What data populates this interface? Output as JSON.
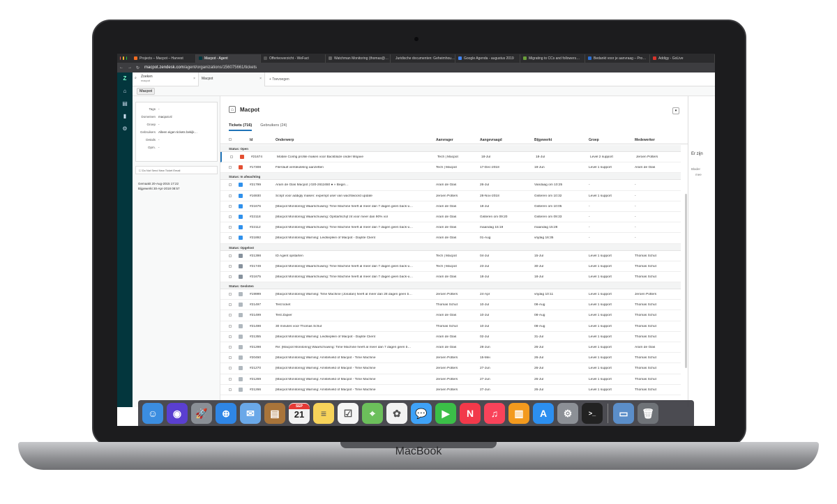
{
  "device": {
    "brand": "MacBook"
  },
  "browser": {
    "tabs": [
      {
        "label": "Projects – Macpot – Harvest",
        "icon_color": "#f36c21",
        "active": false
      },
      {
        "label": "Macpot - Agent",
        "icon_color": "#03363d",
        "active": true
      },
      {
        "label": "Offerteoverzicht - WeFact",
        "icon_color": "#555555",
        "active": false
      },
      {
        "label": "Watchman Monitoring (thomas@…",
        "icon_color": "#666666",
        "active": false
      },
      {
        "label": "Juridische documenten: Geheimhou…",
        "icon_color": "#3a6bd8",
        "active": false
      },
      {
        "label": "Google Agenda - augustus 2019",
        "icon_color": "#4285f4",
        "active": false
      },
      {
        "label": "Migrating to CCs and followers…",
        "icon_color": "#6a9e3a",
        "active": false
      },
      {
        "label": "Bedankt voor je aanvraag – Pro…",
        "icon_color": "#2c6fd1",
        "active": false
      },
      {
        "label": "Addigy - GoLive",
        "icon_color": "#d9342b",
        "active": false
      }
    ],
    "url_domain": "macpot.zendesk.com",
    "url_path": "/agent/organizations/156075661/tickets"
  },
  "app": {
    "search_tab": {
      "title": "Zoeken",
      "subtitle": "macpot"
    },
    "org_tab": "Macpot",
    "add_tab": "+ Toevoegen",
    "breadcrumb": "Macpot"
  },
  "org_props": {
    "rows": [
      {
        "k": "Tags",
        "v": "-"
      },
      {
        "k": "Domeinen",
        "v": "macpot.nl"
      },
      {
        "k": "Groep",
        "v": "-"
      },
      {
        "k": "Gebruikers",
        "v": "Alleen eigen tickets bekijk…"
      },
      {
        "k": "Details",
        "v": "-"
      },
      {
        "k": "Opm.",
        "v": "-"
      }
    ],
    "checkbox_label": "Do Not Send New Ticket Email",
    "created_label": "Gemaakt",
    "created": "20-Aug-2015 17:22",
    "updated_label": "Bijgewerkt",
    "updated": "30-Apr-2018 08:57"
  },
  "org": {
    "name": "Macpot",
    "tab_tickets": "Tickets (716)",
    "tab_users": "Gebruikers (24)"
  },
  "table": {
    "headers": {
      "id": "Id",
      "subject": "Onderwerp",
      "requester": "Aanvrager",
      "requested": "Aangevraagd",
      "updated": "Bijgewerkt",
      "group": "Groep",
      "assignee": "Medewerker"
    },
    "groups": [
      {
        "label": "Status: Open",
        "color": "#e34f32",
        "rows": [
          [
            "#21674",
            "Mobile Config profile maken voor Backblaze onder Mojave",
            "Tech | Macpot",
            "18-Jul",
            "18-Jul",
            "Level 2 support",
            "Jeroen Potters"
          ],
          [
            "#17308",
            "FileVault versleuteling aanzetten",
            "Tech | Macpot",
            "17-Dec-2018",
            "19-Jun",
            "Level 1 support",
            "Aram de Glas"
          ]
        ]
      },
      {
        "label": "Status: In afwachting",
        "color": "#3091ec",
        "rows": [
          [
            "#21799",
            "Aram de Glas Macpot | 020-2611650 ● » Begin…",
            "Aram de Glas",
            "26-Jul",
            "Vandaag om 10:25",
            "-",
            "-"
          ],
          [
            "#16930",
            "Script voor addigly maken: expempt user van wachtwoord update",
            "Jeroen Potters",
            "28-Nov-2018",
            "Gisteren om 10:32",
            "Level 1 support",
            "-"
          ],
          [
            "#21676",
            "[Macpot Monitoring] Waarschuwing: Time Machine heeft al meer dan 7 dagen geen back-u…",
            "Aram de Glas",
            "18-Jul",
            "Gisteren om 10:05",
            "-",
            "-"
          ],
          [
            "#22118",
            "[Macpot Monitoring] Waarschuwing: Opstartschijf zit voor meer dan 90% vol",
            "Aram de Glas",
            "Gisteren om 09:20",
            "Gisteren om 09:33",
            "-",
            "-"
          ],
          [
            "#22112",
            "[Macpot Monitoring] Waarschuwing: Time Machine heeft al meer dan 7 dagen geen back-u…",
            "Aram de Glas",
            "maandag 15:19",
            "maandag 15:28",
            "-",
            "-"
          ],
          [
            "#21892",
            "[Macpot Monitoring] Warning: Leidseplein of Macpot - Daylite Client",
            "Aram de Glas",
            "01-Aug",
            "vrijdag 16:35",
            "-",
            "-"
          ]
        ]
      },
      {
        "label": "Status: Opgelost",
        "color": "#87929d",
        "rows": [
          [
            "#21398",
            "ID Agent opstarten",
            "Tech | Macpot",
            "04-Jul",
            "15-Jul",
            "Level 1 support",
            "Thomas Schut"
          ],
          [
            "#21749",
            "[Macpot Monitoring] Waarschuwing: Time Machine heeft al meer dan 7 dagen geen back-u…",
            "Tech | Macpot",
            "23-Jul",
            "30-Jul",
            "Level 1 support",
            "Thomas Schut"
          ],
          [
            "#21675",
            "[Macpot Monitoring] Waarschuwing: Time Machine heeft al meer dan 7 dagen geen back-u…",
            "Aram de Glas",
            "18-Jul",
            "18-Jul",
            "Level 1 support",
            "Thomas Schut"
          ]
        ]
      },
      {
        "label": "Status: Gesloten",
        "color": "#b0b8be",
        "rows": [
          [
            "#19999",
            "[Macpot Monitoring] Warning: Time Machine (Jonatan) heeft al meer dan 28 dagen geen b…",
            "Jeroen Potters",
            "24-Apr",
            "vrijdag 10:11",
            "Level 1 support",
            "Jeroen Potters"
          ],
          [
            "#21497",
            "Test ticket",
            "Thomas Schut",
            "10-Jul",
            "08-Aug",
            "Level 1 support",
            "Thomas Schut"
          ],
          [
            "#21499",
            "Test Zapier",
            "Aram de Glas",
            "10-Jul",
            "08-Aug",
            "Level 1 support",
            "Thomas Schut"
          ],
          [
            "#21498",
            "30 minutes voor Thomas Schut",
            "Thomas Schut",
            "10-Jul",
            "08-Aug",
            "Level 1 support",
            "Thomas Schut"
          ],
          [
            "#21355",
            "[Macpot Monitoring] Warning: Leidseplein of Macpot - Daylite Client",
            "Aram de Glas",
            "02-Jul",
            "31-Jul",
            "Level 1 support",
            "Thomas Schut"
          ],
          [
            "#21298",
            "Re: [Macpot Monitoring] Waarschuwing: Time Machine heeft al meer dan 7 dagen geen b…",
            "Aram de Glas",
            "28-Jun",
            "26-Jul",
            "Level 1 support",
            "Aram de Glas"
          ],
          [
            "#20450",
            "[Macpot Monitoring] Warning: Amstelveld of Macpot - Time Machine",
            "Jeroen Potters",
            "15-Mei",
            "26-Jul",
            "Level 1 support",
            "Thomas Schut"
          ],
          [
            "#21270",
            "[Macpot Monitoring] Warning: Amstelveld of Macpot - Time Machine",
            "Jeroen Potters",
            "27-Jun",
            "26-Jul",
            "Level 1 support",
            "Thomas Schut"
          ],
          [
            "#21269",
            "[Macpot Monitoring] Warning: Amstelveld of Macpot - Time Machine",
            "Jeroen Potters",
            "27-Jun",
            "26-Jul",
            "Level 1 support",
            "Thomas Schut"
          ],
          [
            "#21266",
            "[Macpot Monitoring] Warning: Amstelveld of Macpot - Time Machine",
            "Jeroen Potters",
            "27-Jun",
            "26-Jul",
            "Level 1 support",
            "Thomas Schut"
          ]
        ]
      }
    ]
  },
  "right_panel": {
    "line1": "Er zijn",
    "line2": "Blader",
    "line3": "mee"
  },
  "dock": {
    "items": [
      {
        "name": "finder-icon",
        "color": "#3b8de0",
        "glyph": "☺"
      },
      {
        "name": "siri-icon",
        "color": "#5a3fd0",
        "glyph": "◉"
      },
      {
        "name": "launchpad-icon",
        "color": "#8a8f96",
        "glyph": "🚀"
      },
      {
        "name": "safari-icon",
        "color": "#2f86e6",
        "glyph": "⊕"
      },
      {
        "name": "mail-icon",
        "color": "#6aa8e8",
        "glyph": "✉"
      },
      {
        "name": "contacts-icon",
        "color": "#a8743a",
        "glyph": "▤"
      },
      {
        "name": "calendar-icon",
        "color": "#f2f2f2",
        "glyph": "21"
      },
      {
        "name": "notes-icon",
        "color": "#f7d35a",
        "glyph": "≡"
      },
      {
        "name": "reminders-icon",
        "color": "#f5f5f5",
        "glyph": "☑"
      },
      {
        "name": "maps-icon",
        "color": "#6cbf5b",
        "glyph": "⌖"
      },
      {
        "name": "photos-icon",
        "color": "#f2f2f2",
        "glyph": "✿"
      },
      {
        "name": "messages-icon",
        "color": "#3fa2f7",
        "glyph": "💬"
      },
      {
        "name": "facetime-icon",
        "color": "#3bbf48",
        "glyph": "▶"
      },
      {
        "name": "news-icon",
        "color": "#f2394a",
        "glyph": "N"
      },
      {
        "name": "music-icon",
        "color": "#f9435a",
        "glyph": "♫"
      },
      {
        "name": "books-icon",
        "color": "#f39a1e",
        "glyph": "▥"
      },
      {
        "name": "appstore-icon",
        "color": "#2c8ff0",
        "glyph": "A"
      },
      {
        "name": "system-preferences-icon",
        "color": "#8c9096",
        "glyph": "⚙"
      },
      {
        "name": "terminal-icon",
        "color": "#222222",
        "glyph": ">_"
      },
      {
        "name": "downloads-folder-icon",
        "color": "#5b8ec9",
        "glyph": "▭"
      },
      {
        "name": "trash-icon",
        "color": "#6f7378",
        "glyph": "🗑"
      }
    ],
    "calendar_month": "SEP"
  }
}
